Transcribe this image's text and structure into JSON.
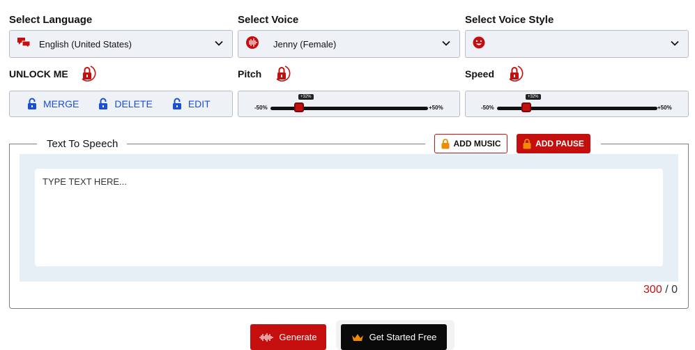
{
  "language": {
    "label": "Select Language",
    "value": "English (United States)"
  },
  "voice": {
    "label": "Select Voice",
    "value": "Jenny (Female)"
  },
  "voice_style": {
    "label": "Select Voice Style",
    "value": ""
  },
  "unlock": {
    "label": "UNLOCK ME",
    "buttons": {
      "merge": "MERGE",
      "delete": "DELETE",
      "edit": "EDIT"
    }
  },
  "pitch": {
    "label": "Pitch",
    "min": "-50%",
    "max": "+50%",
    "tooltip": "+32%"
  },
  "speed": {
    "label": "Speed",
    "min": "-50%",
    "max": "+50%",
    "tooltip": "+32%"
  },
  "tts": {
    "title": "Text To Speech",
    "add_music": "ADD MUSIC",
    "add_pause": "ADD PAUSE",
    "placeholder": "TYPE TEXT HERE...",
    "max_chars": "300",
    "separator": "/",
    "current_chars": "0"
  },
  "actions": {
    "generate": "Generate",
    "get_started": "Get Started Free"
  },
  "colors": {
    "accent_red": "#c50f0f",
    "link_blue": "#1a4fd6",
    "panel_bg": "#eef1f5"
  }
}
